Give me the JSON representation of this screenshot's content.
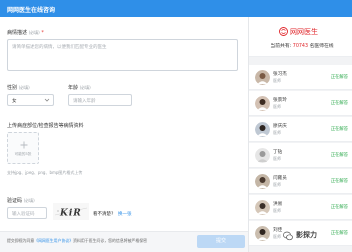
{
  "header": {
    "title": "网网医生在线咨询"
  },
  "form": {
    "description": {
      "label": "病情描述",
      "hint": "(必填)",
      "required_mark": "*",
      "placeholder": "请简单描述您的病情，以便我们匹配专业的医生"
    },
    "gender": {
      "label": "性别",
      "hint": "(必填)",
      "value": "女"
    },
    "age": {
      "label": "年龄",
      "hint": "(必填)",
      "placeholder": "请输入年龄"
    },
    "upload": {
      "label": "上传病症部位/检查报告等病情资料",
      "button_text": "可能的3张",
      "note": "支持jpg、jpeg、png、bmp图片格式上传"
    },
    "captcha": {
      "label": "验证码",
      "hint": "(必填)",
      "placeholder": "输入验证码",
      "image_text": "KiR",
      "question": "看不清楚?",
      "refresh_link": "换一张"
    },
    "footer": {
      "agree_text": "提交即视为同意",
      "terms_link": "《网网医生用户协议》",
      "rest_text": "资料用于医生问诊，您的信息将被严格保密",
      "submit_label": "提交"
    }
  },
  "panel": {
    "logo_text": "网网医生",
    "online_prefix": "当前共有:",
    "online_count": "70743",
    "online_suffix": "名医师在线",
    "doctors": [
      {
        "name": "张习杰",
        "title": "医师",
        "status": "正在解答"
      },
      {
        "name": "张景玲",
        "title": "医师",
        "status": "正在解答"
      },
      {
        "name": "廖庆庆",
        "title": "医师",
        "status": "正在解答"
      },
      {
        "name": "丁钻",
        "title": "医师",
        "status": "正在解答"
      },
      {
        "name": "闫雍员",
        "title": "医师",
        "status": "正在解答"
      },
      {
        "name": "洪易",
        "title": "医师",
        "status": "正在解答"
      },
      {
        "name": "刘佳",
        "title": "医师",
        "status": "正在解答"
      }
    ]
  },
  "watermark": {
    "text": "影探力"
  },
  "colors": {
    "primary": "#2f8fe8",
    "brand_red": "#e0262b",
    "status_green": "#2aa84a"
  }
}
